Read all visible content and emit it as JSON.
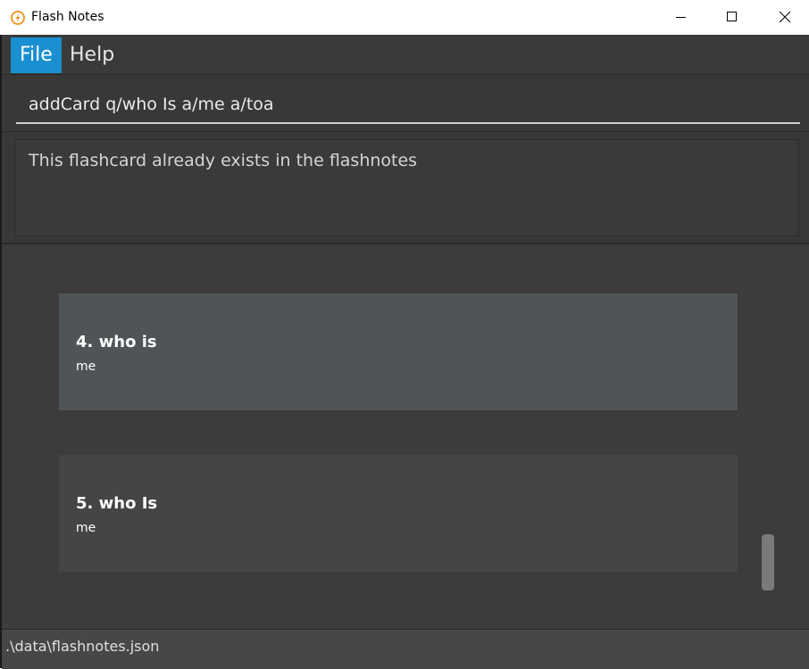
{
  "window": {
    "title": "Flash Notes",
    "icon": "lightning-bolt-icon",
    "controls": [
      "minimize-icon",
      "maximize-icon",
      "close-icon"
    ]
  },
  "menu": {
    "file_label": "File",
    "help_label": "Help"
  },
  "command": {
    "value": "addCard q/who Is a/me a/toa"
  },
  "result": {
    "message": "This flashcard already exists in the flashnotes"
  },
  "cards": [
    {
      "question": "4.  who is",
      "answer": "me"
    },
    {
      "question": "5.  who Is",
      "answer": "me"
    }
  ],
  "status": {
    "path": ".\\data\\flashnotes.json"
  },
  "colors": {
    "accent": "#1a8fd1",
    "background": "#3c3c3c",
    "selected_card": "#4f5457",
    "card": "#434547"
  }
}
